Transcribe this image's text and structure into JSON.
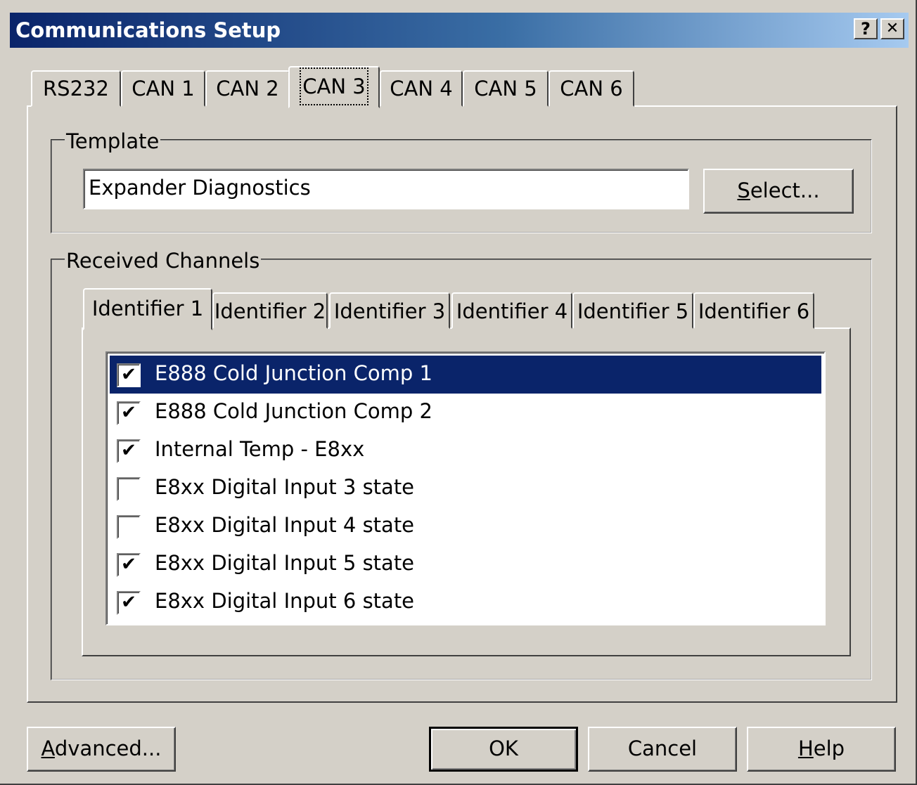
{
  "window": {
    "title": "Communications Setup",
    "help_button": "?",
    "close_button": "✕"
  },
  "tabs": [
    {
      "label": "RS232",
      "active": false
    },
    {
      "label": "CAN 1",
      "active": false
    },
    {
      "label": "CAN 2",
      "active": false
    },
    {
      "label": "CAN 3",
      "active": true
    },
    {
      "label": "CAN 4",
      "active": false
    },
    {
      "label": "CAN 5",
      "active": false
    },
    {
      "label": "CAN 6",
      "active": false
    }
  ],
  "template": {
    "group_label": "Template",
    "value": "Expander Diagnostics",
    "select_button": {
      "mnemonic": "S",
      "rest": "elect..."
    }
  },
  "received": {
    "group_label": "Received Channels",
    "identifier_tabs": [
      {
        "label": "Identifier 1",
        "active": true
      },
      {
        "label": "Identifier 2",
        "active": false
      },
      {
        "label": "Identifier 3",
        "active": false
      },
      {
        "label": "Identifier 4",
        "active": false
      },
      {
        "label": "Identifier 5",
        "active": false
      },
      {
        "label": "Identifier 6",
        "active": false
      }
    ],
    "channels": [
      {
        "label": "E888 Cold Junction Comp 1",
        "checked": true,
        "selected": true
      },
      {
        "label": "E888 Cold Junction Comp 2",
        "checked": true,
        "selected": false
      },
      {
        "label": "Internal Temp - E8xx",
        "checked": true,
        "selected": false
      },
      {
        "label": "E8xx Digital Input 3 state",
        "checked": false,
        "selected": false
      },
      {
        "label": "E8xx Digital Input 4 state",
        "checked": false,
        "selected": false
      },
      {
        "label": "E8xx Digital Input 5 state",
        "checked": true,
        "selected": false
      },
      {
        "label": "E8xx Digital Input 6 state",
        "checked": true,
        "selected": false
      }
    ]
  },
  "buttons": {
    "advanced": {
      "mnemonic": "A",
      "rest": "dvanced..."
    },
    "ok": "OK",
    "cancel": "Cancel",
    "help": {
      "mnemonic": "H",
      "rest": "elp"
    }
  },
  "colors": {
    "face": "#d4d0c8",
    "selection": "#0a246a",
    "title_gradient_start": "#0a246a",
    "title_gradient_end": "#a6caf0"
  }
}
